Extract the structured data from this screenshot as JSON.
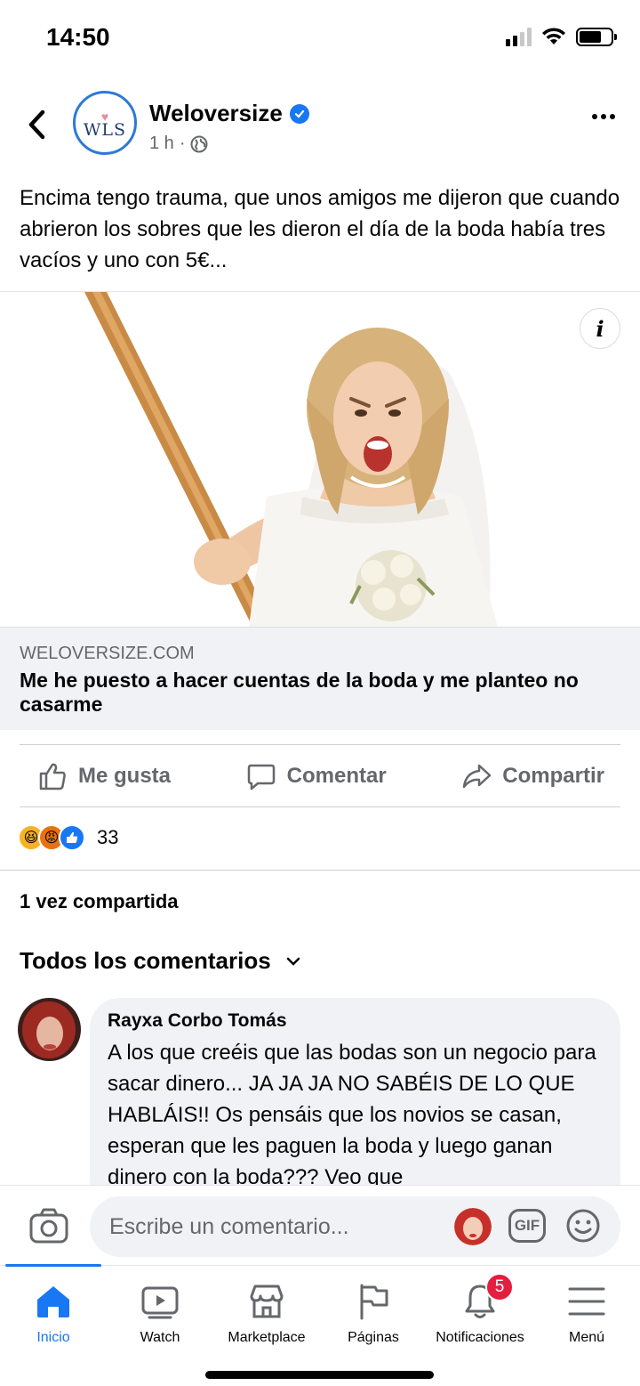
{
  "status_bar": {
    "time": "14:50",
    "battery_level": 0.7
  },
  "post": {
    "page_name": "Weloversize",
    "page_avatar_text": "WLS",
    "time_ago": "1 h",
    "separator": "·",
    "text": "Encima tengo trauma, que unos amigos me dijeron que cuando abrieron los sobres que les dieron el día de la boda había tres vacíos y uno con 5€...",
    "link": {
      "domain": "WELOVERSIZE.COM",
      "title": "Me he puesto a hacer cuentas de la boda y me planteo no casarme",
      "info_label": "i"
    }
  },
  "actions": {
    "like": "Me gusta",
    "comment": "Comentar",
    "share": "Compartir"
  },
  "reactions": {
    "types": [
      "haha",
      "angry",
      "like"
    ],
    "count": "33"
  },
  "shares_text": "1 vez compartida",
  "comments_filter": "Todos los comentarios",
  "comment": {
    "author": "Rayxa Corbo Tomás",
    "text": "A los que creéis que las bodas son un negocio para sacar dinero... JA JA JA NO SABÉIS DE LO QUE HABLÁIS!! Os pensáis que los novios se casan, esperan que les paguen la boda y luego ganan dinero con la boda??? Veo que"
  },
  "composer": {
    "placeholder": "Escribe un comentario...",
    "gif_label": "GIF"
  },
  "bottom_nav": {
    "items": [
      {
        "label": "Inicio",
        "icon": "home-icon",
        "active": true
      },
      {
        "label": "Watch",
        "icon": "watch-icon"
      },
      {
        "label": "Marketplace",
        "icon": "marketplace-icon"
      },
      {
        "label": "Páginas",
        "icon": "flag-icon"
      },
      {
        "label": "Notificaciones",
        "icon": "bell-icon",
        "badge": "5"
      },
      {
        "label": "Menú",
        "icon": "menu-icon"
      }
    ]
  },
  "colors": {
    "accent": "#1877f2",
    "secondary_text": "#65676b",
    "badge": "#e41e3f",
    "bubble": "#f0f2f5"
  }
}
